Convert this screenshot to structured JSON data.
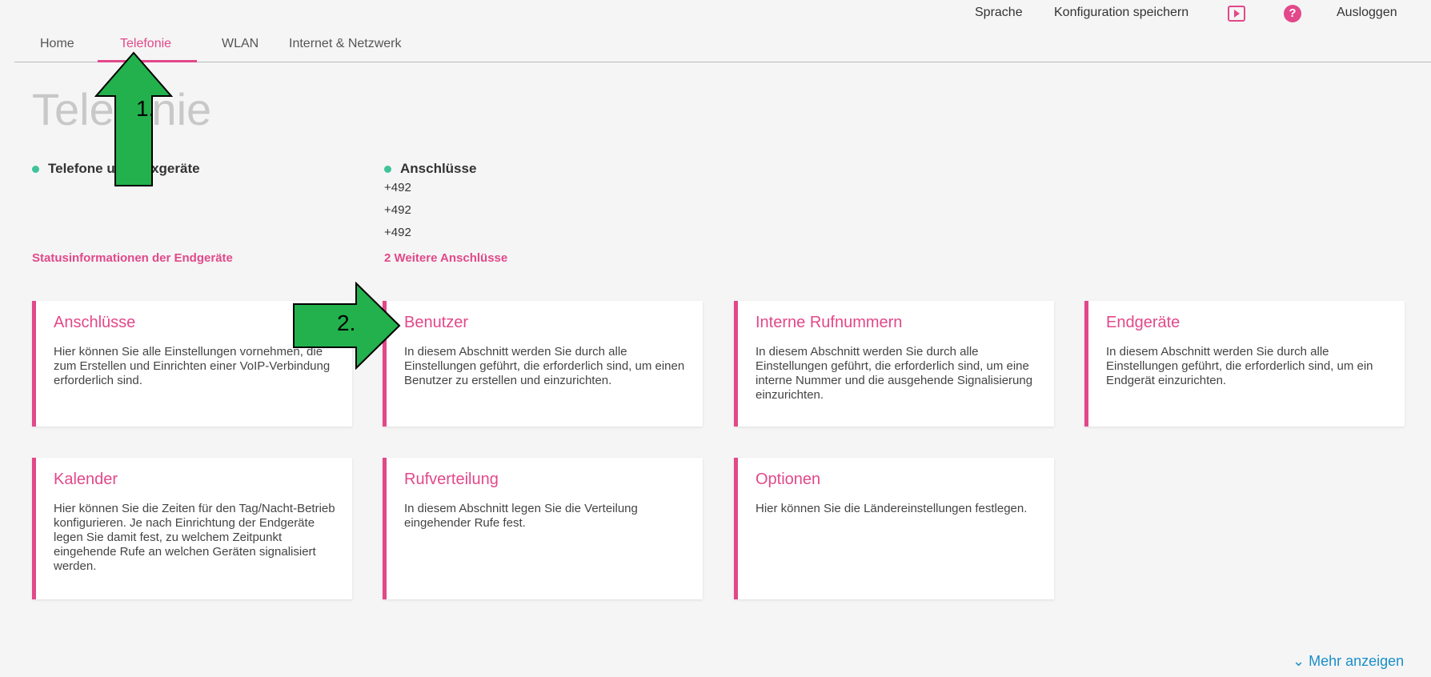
{
  "topbar": {
    "language": "Sprache",
    "save_config": "Konfiguration speichern",
    "logout": "Ausloggen",
    "icons": [
      "tv-play-icon",
      "help-icon"
    ],
    "help_glyph": "?"
  },
  "tabs": [
    {
      "label": "Home"
    },
    {
      "label": "Telefonie",
      "active": true
    },
    {
      "label": "WLAN"
    },
    {
      "label": "Internet & Netzwerk"
    }
  ],
  "page_title": "Telefonie",
  "status": {
    "phones": {
      "label": "Telefone und Faxgeräte",
      "link": "Statusinformationen der Endgeräte"
    },
    "connections": {
      "label": "Anschlüsse",
      "numbers": [
        "+492",
        "+492",
        "+492"
      ],
      "link": "2 Weitere Anschlüsse"
    }
  },
  "cards": [
    {
      "title": "Anschlüsse",
      "desc": "Hier können Sie alle Einstellungen vornehmen, die zum Erstellen und Einrichten einer VoIP-Verbindung erforderlich sind."
    },
    {
      "title": "Benutzer",
      "desc": "In diesem Abschnitt werden Sie durch alle Einstellungen geführt, die erforderlich sind, um einen Benutzer zu erstellen und einzurichten."
    },
    {
      "title": "Interne Rufnummern",
      "desc": "In diesem Abschnitt werden Sie durch alle Einstellungen geführt, die erforderlich sind, um eine interne Nummer und die ausgehende Signalisierung einzurichten."
    },
    {
      "title": "Endgeräte",
      "desc": "In diesem Abschnitt werden Sie durch alle Einstellungen geführt, die erforderlich sind, um ein Endgerät einzurichten."
    },
    {
      "title": "Kalender",
      "desc": "Hier können Sie die Zeiten für den Tag/Nacht-Betrieb konfigurieren. Je nach Einrichtung der Endgeräte legen Sie damit fest, zu welchem Zeitpunkt eingehende Rufe an welchen Geräten signalisiert werden."
    },
    {
      "title": "Rufverteilung",
      "desc": "In diesem Abschnitt legen Sie die Verteilung eingehender Rufe fest."
    },
    {
      "title": "Optionen",
      "desc": "Hier können Sie die Ländereinstellungen festlegen."
    }
  ],
  "more": "Mehr anzeigen",
  "annotations": {
    "step1": "1.",
    "step2": "2.",
    "color": "#22b14c"
  },
  "colors": {
    "accent": "#e2488a",
    "status_dot": "#3fc39a",
    "link_blue": "#1a8fc9"
  }
}
